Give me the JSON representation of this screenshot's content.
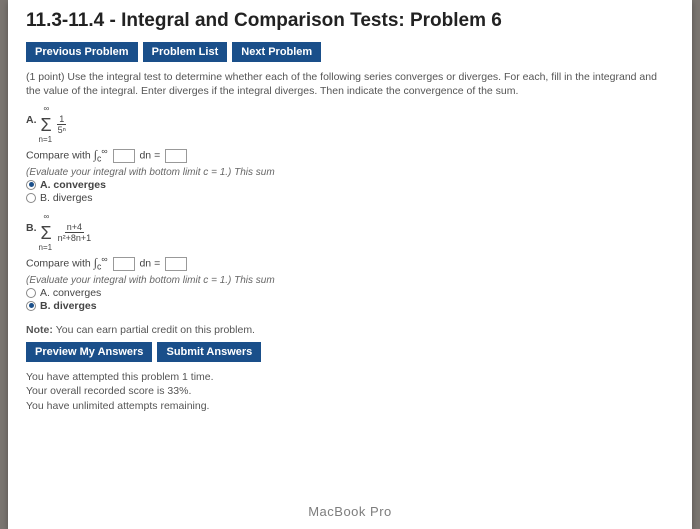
{
  "title": "11.3-11.4 - Integral and Comparison Tests: Problem 6",
  "nav": {
    "prev": "Previous Problem",
    "list": "Problem List",
    "next": "Next Problem"
  },
  "instructions": "(1 point) Use the integral test to determine whether each of the following series converges or diverges. For each, fill in the integrand and the value of the integral. Enter diverges if the integral diverges. Then indicate the convergence of the sum.",
  "partA": {
    "letter": "A.",
    "frac_num": "1",
    "frac_den": "5ⁿ",
    "compare_prefix": "Compare with ",
    "int_sym": "∫",
    "int_upper": "∞",
    "int_lower": "c",
    "dn_eq": " dn = ",
    "hint": "(Evaluate your integral with bottom limit c = 1.) This sum",
    "optA": "A. converges",
    "optB": "B. diverges",
    "selected": "A"
  },
  "partB": {
    "letter": "B.",
    "frac_num": "n+4",
    "frac_den": "n²+8n+1",
    "compare_prefix": "Compare with ",
    "int_sym": "∫",
    "int_upper": "∞",
    "int_lower": "c",
    "dn_eq": " dn = ",
    "hint": "(Evaluate your integral with bottom limit c = 1.) This sum",
    "optA": "A. converges",
    "optB": "B. diverges",
    "selected": "B"
  },
  "note_prefix": "Note: ",
  "note_text": "You can earn partial credit on this problem.",
  "buttons": {
    "preview": "Preview My Answers",
    "submit": "Submit Answers"
  },
  "status": {
    "line1": "You have attempted this problem 1 time.",
    "line2": "Your overall recorded score is 33%.",
    "line3": "You have unlimited attempts remaining."
  },
  "footer": "MacBook Pro"
}
